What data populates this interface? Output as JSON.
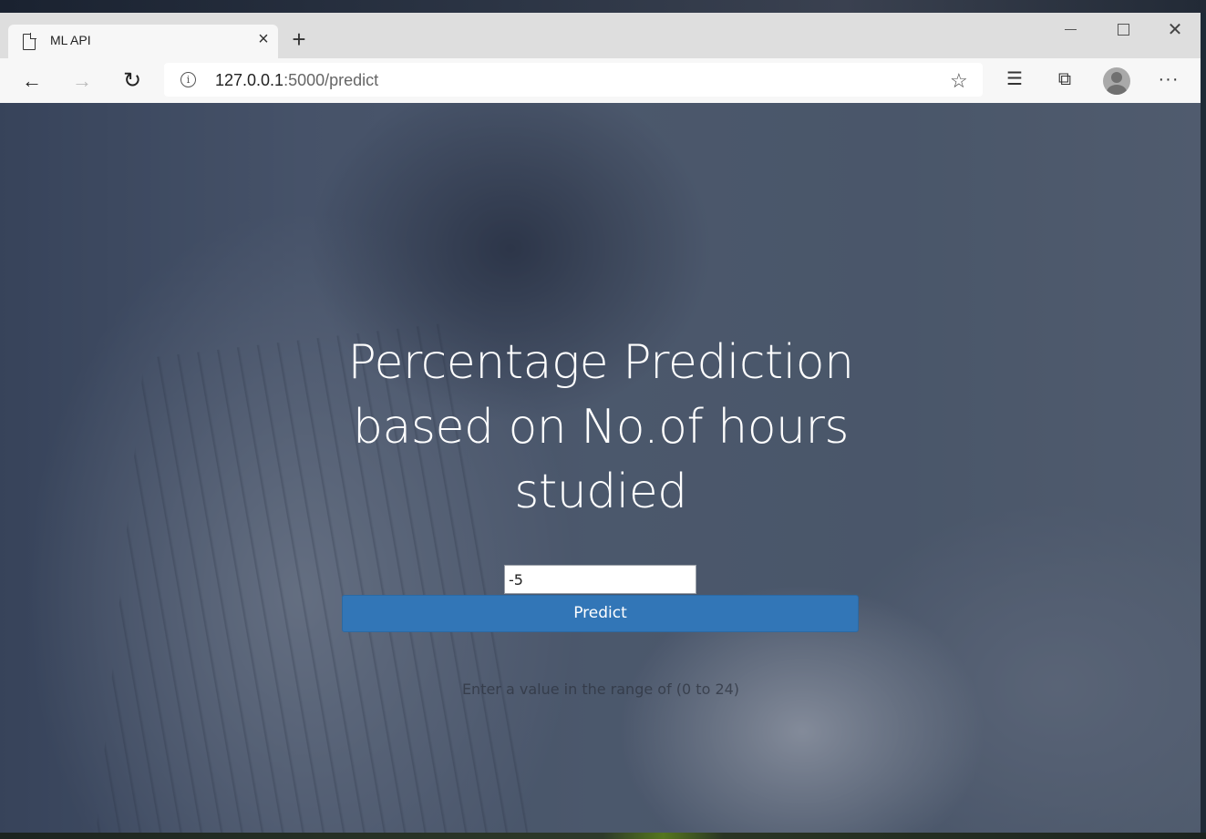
{
  "browser": {
    "tab_title": "ML API",
    "new_tab_symbol": "+",
    "url_host": "127.0.0.1",
    "url_rest": ":5000/predict",
    "window_controls": [
      "minimize-icon",
      "maximize-icon",
      "close-icon"
    ],
    "toolbar_icons": [
      "back-arrow-icon",
      "forward-arrow-icon",
      "refresh-icon",
      "info-icon",
      "add-favorite-star-icon",
      "favorites-icon",
      "collections-icon",
      "profile-avatar",
      "more-icon"
    ]
  },
  "page": {
    "heading": "Percentage Prediction based on No.of hours studied",
    "input_value": "-5",
    "predict_label": "Predict",
    "hint": "Enter a value in the range of (0 to 24)",
    "button_color": "#3276b7"
  }
}
